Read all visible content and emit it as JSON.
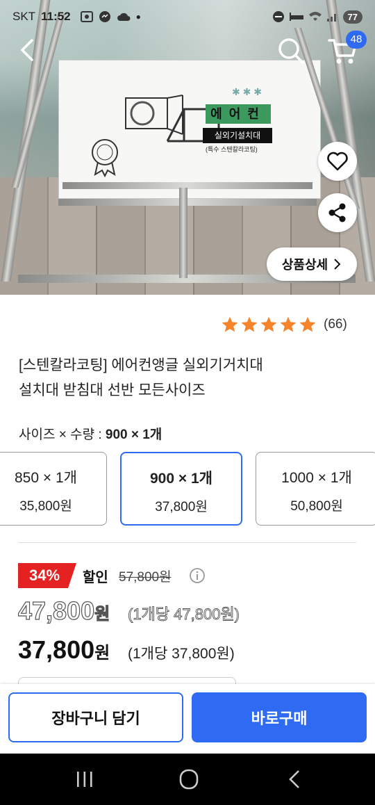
{
  "status_bar": {
    "carrier": "SKT",
    "time": "11:52",
    "battery": "77"
  },
  "header": {
    "cart_count": "48"
  },
  "hero": {
    "box_label_main": "에어컨",
    "box_label_sub": "실외기설치대",
    "box_label_note": "(특수 스텐칼라코팅)"
  },
  "detail_button": {
    "label": "상품상세"
  },
  "rating": {
    "stars": 5,
    "count": "(66)"
  },
  "product": {
    "title_line1": "[스텐칼라코팅] 에어컨앵글 실외기거치대",
    "title_line2": "설치대 받침대 선반 모든사이즈"
  },
  "option": {
    "label": "사이즈 × 수량 : ",
    "selected": "900 × 1개",
    "items": [
      {
        "name": "850 × 1개",
        "price": "35,800원"
      },
      {
        "name": "900 × 1개",
        "price": "37,800원"
      },
      {
        "name": "1000 × 1개",
        "price": "50,800원"
      }
    ]
  },
  "pricing": {
    "discount_percent": "34%",
    "discount_word": "할인",
    "original_price": "57,800원",
    "sale_price_number": "47,800",
    "sale_price_won": "원",
    "sale_unit": "(1개당 47,800원)",
    "final_price_number": "37,800",
    "final_price_won": "원",
    "final_unit": "(1개당 37,800원)"
  },
  "actions": {
    "cart_label": "장바구니 담기",
    "buy_label": "바로구매"
  },
  "colors": {
    "accent": "#2e6bf2",
    "discount": "#e52222",
    "star": "#f5832a"
  }
}
